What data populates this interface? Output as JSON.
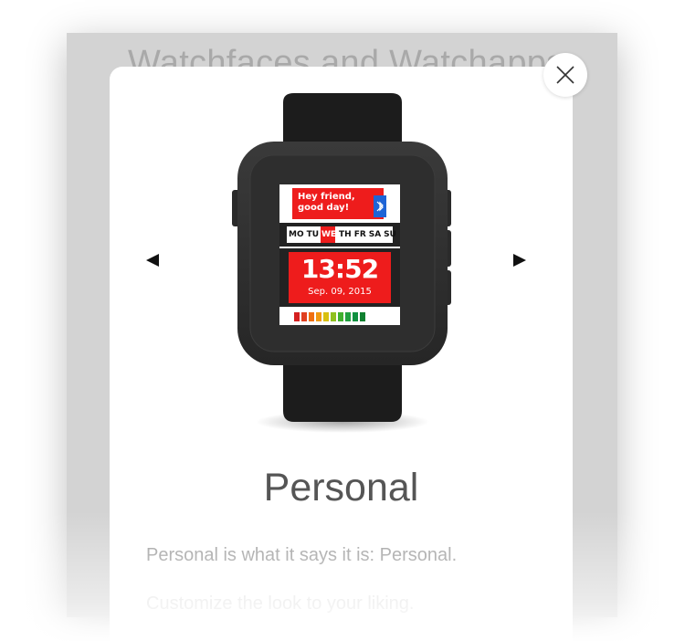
{
  "background": {
    "title": "Watchfaces and Watchapps"
  },
  "modal": {
    "close_icon": "close-icon",
    "prev_icon": "triangle-left-icon",
    "next_icon": "triangle-right-icon",
    "app_title": "Personal",
    "description_line1": "Personal is what it says it is: Personal.",
    "description_line2": "Customize the look to your liking."
  },
  "watch_screen": {
    "greeting_line1": "Hey friend,",
    "greeting_line2": "good day!",
    "days": [
      "MO",
      "TU",
      "WE",
      "TH",
      "FR",
      "SA",
      "SU"
    ],
    "highlight_day": "WE",
    "time": "13:52",
    "date": "Sep. 09, 2015",
    "bluetooth_icon": "bluetooth-icon",
    "colors": {
      "accent": "#ee1c1c",
      "bluetooth_badge": "#1e64d6",
      "watch_body": "#2b2b2b",
      "strap": "#1c1c1c"
    }
  }
}
